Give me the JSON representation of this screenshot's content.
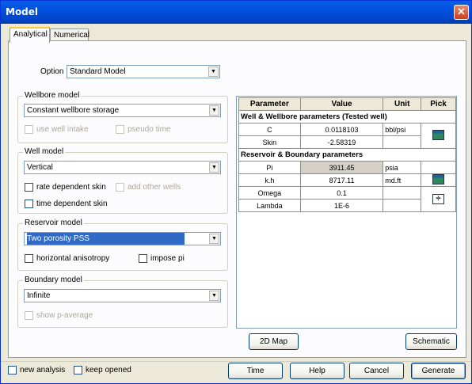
{
  "window": {
    "title": "Model"
  },
  "tabs": [
    {
      "label": "Analytical"
    },
    {
      "label": "Numerical"
    }
  ],
  "option": {
    "label": "Option",
    "value": "Standard Model"
  },
  "wellbore": {
    "group": "Wellbore model",
    "value": "Constant wellbore storage",
    "use_well_intake": "use well intake",
    "pseudo_time": "pseudo time"
  },
  "well": {
    "group": "Well model",
    "value": "Vertical",
    "rate_dependent_skin": "rate dependent skin",
    "add_other_wells": "add other wells",
    "time_dependent_skin": "time dependent skin"
  },
  "reservoir": {
    "group": "Reservoir model",
    "value": "Two porosity PSS",
    "horizontal_anisotropy": "horizontal anisotropy",
    "impose_pi": "impose pi"
  },
  "boundary": {
    "group": "Boundary model",
    "value": "Infinite",
    "show_p_average": "show p-average"
  },
  "table": {
    "headers": [
      "Parameter",
      "Value",
      "Unit",
      "Pick"
    ],
    "section_well": "Well & Wellbore parameters (Tested well)",
    "section_res": "Reservoir & Boundary parameters",
    "rows": [
      {
        "param": "C",
        "value": "0.0118103",
        "unit": "bbl/psi"
      },
      {
        "param": "Skin",
        "value": "-2.58319",
        "unit": ""
      },
      {
        "param": "Pi",
        "value": "3911.45",
        "unit": "psia"
      },
      {
        "param": "k.h",
        "value": "8717.11",
        "unit": "md.ft"
      },
      {
        "param": "Omega",
        "value": "0.1",
        "unit": ""
      },
      {
        "param": "Lambda",
        "value": "1E-6",
        "unit": ""
      }
    ]
  },
  "buttons": {
    "map2d": "2D Map",
    "schematic": "Schematic",
    "time": "Time",
    "help": "Help",
    "cancel": "Cancel",
    "generate": "Generate"
  },
  "footer": {
    "new_analysis": "new analysis",
    "keep_opened": "keep opened"
  },
  "colors": {
    "title_bar": "#0054e3",
    "selection": "#316ac5"
  },
  "icons": {
    "close": "close-icon",
    "pick_c": "calculator-icon",
    "pick_kh": "calculator-icon",
    "pick_omega": "divide-icon"
  }
}
